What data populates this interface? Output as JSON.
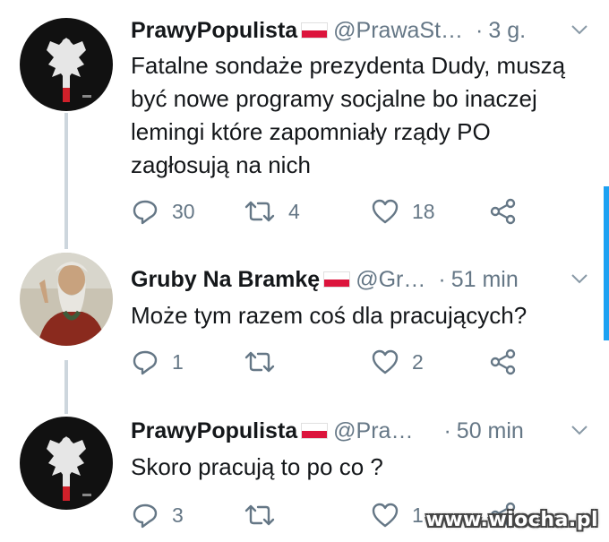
{
  "tweets": [
    {
      "name": "PrawyPopulista",
      "handle": "@PrawaSt…",
      "time": "3 g.",
      "text": "Fatalne sondaże prezydenta Dudy, muszą być nowe programy socjalne bo inaczej lemingi które zapomniały rządy PO zagłosują na nich",
      "replies": "30",
      "retweets": "4",
      "likes": "18"
    },
    {
      "name": "Gruby Na Bramkę",
      "handle": "@Gr…",
      "time": "51 min",
      "text": "Może tym razem coś dla pracujących?",
      "replies": "1",
      "retweets": "",
      "likes": "2"
    },
    {
      "name": "PrawyPopulista",
      "handle": "@Pra…",
      "time": "50 min",
      "text": "Skoro pracują to po co ?",
      "replies": "3",
      "retweets": "",
      "likes": "1"
    }
  ],
  "separator": "·",
  "watermark": "www.wiocha.pl",
  "colors": {
    "accent": "#1da1f2",
    "muted": "#657786",
    "flag_red": "#dc143c"
  },
  "icons": [
    "reply-icon",
    "retweet-icon",
    "like-icon",
    "share-icon",
    "chevron-down-icon"
  ]
}
